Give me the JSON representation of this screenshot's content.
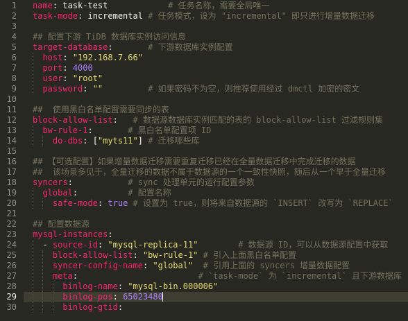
{
  "editor": {
    "language": "yaml",
    "active_line": 29,
    "lines": [
      {
        "no": "1",
        "tokens": [
          [
            "k",
            "name"
          ],
          [
            "p",
            ": "
          ],
          [
            "p",
            "task-test"
          ],
          [
            "p",
            "            "
          ],
          [
            "c",
            "# 任务名称，需要全局唯一"
          ]
        ]
      },
      {
        "no": "2",
        "tokens": [
          [
            "k",
            "task-mode"
          ],
          [
            "p",
            ": "
          ],
          [
            "p",
            "incremental"
          ],
          [
            "p",
            " "
          ],
          [
            "c",
            "# 任务模式，设为 \"incremental\" 即只进行增量数据迁移"
          ]
        ]
      },
      {
        "no": "3",
        "tokens": []
      },
      {
        "no": "4",
        "tokens": [
          [
            "c",
            "## 配置下游 TiDB 数据库实例访问信息"
          ]
        ]
      },
      {
        "no": "5",
        "tokens": [
          [
            "k",
            "target-database"
          ],
          [
            "p",
            ":       "
          ],
          [
            "c",
            "# 下游数据库实例配置"
          ]
        ]
      },
      {
        "no": "6",
        "tokens": [
          [
            "p",
            "  "
          ],
          [
            "k",
            "host"
          ],
          [
            "p",
            ": "
          ],
          [
            "s",
            "\"192.168.7.66\""
          ]
        ]
      },
      {
        "no": "7",
        "tokens": [
          [
            "p",
            "  "
          ],
          [
            "k",
            "port"
          ],
          [
            "p",
            ": "
          ],
          [
            "n",
            "4000"
          ]
        ]
      },
      {
        "no": "8",
        "tokens": [
          [
            "p",
            "  "
          ],
          [
            "k",
            "user"
          ],
          [
            "p",
            ": "
          ],
          [
            "s",
            "\"root\""
          ]
        ]
      },
      {
        "no": "9",
        "tokens": [
          [
            "p",
            "  "
          ],
          [
            "k",
            "password"
          ],
          [
            "p",
            ": "
          ],
          [
            "s",
            "\"\""
          ],
          [
            "p",
            "         "
          ],
          [
            "c",
            "# 如果密码不为空，则推荐使用经过 dmctl 加密的密文"
          ]
        ]
      },
      {
        "no": "10",
        "tokens": []
      },
      {
        "no": "11",
        "tokens": [
          [
            "c",
            "##  使用黑白名单配置需要同步的表"
          ]
        ]
      },
      {
        "no": "12",
        "tokens": [
          [
            "k",
            "block-allow-list"
          ],
          [
            "p",
            ":   "
          ],
          [
            "c",
            "# 数据源数据库实例匹配的表的 block-allow-list 过滤规则集"
          ]
        ]
      },
      {
        "no": "13",
        "tokens": [
          [
            "p",
            "  "
          ],
          [
            "k",
            "bw-rule-1"
          ],
          [
            "p",
            ":       "
          ],
          [
            "c",
            "# 黑白名单配置项 ID"
          ]
        ]
      },
      {
        "no": "14",
        "tokens": [
          [
            "p",
            "    "
          ],
          [
            "k",
            "do-dbs"
          ],
          [
            "p",
            ": ["
          ],
          [
            "s",
            "\"myts11\""
          ],
          [
            "p",
            "] "
          ],
          [
            "c",
            "# 迁移哪些库"
          ]
        ]
      },
      {
        "no": "15",
        "tokens": []
      },
      {
        "no": "16",
        "tokens": [
          [
            "c",
            "## 【可选配置】如果增量数据迁移需要重复迁移已经在全量数据迁移中完成迁移的数据"
          ]
        ]
      },
      {
        "no": "17",
        "tokens": [
          [
            "c",
            "##  该场景多见于，全量迁移的数据不属于数据源的一个一致性快照，随后从一个早于全量迁移"
          ]
        ]
      },
      {
        "no": "18",
        "tokens": [
          [
            "k",
            "syncers"
          ],
          [
            "p",
            ":           "
          ],
          [
            "c",
            "# sync 处理单元的运行配置参数"
          ]
        ]
      },
      {
        "no": "19",
        "tokens": [
          [
            "p",
            "  "
          ],
          [
            "k",
            "global"
          ],
          [
            "p",
            ":          "
          ],
          [
            "c",
            "# 配置名称"
          ]
        ]
      },
      {
        "no": "20",
        "tokens": [
          [
            "p",
            "    "
          ],
          [
            "k",
            "safe-mode"
          ],
          [
            "p",
            ": "
          ],
          [
            "n",
            "true"
          ],
          [
            "p",
            " "
          ],
          [
            "c",
            "# 设置为 true，则将来自数据源的 `INSERT` 改写为 `REPLACE`"
          ]
        ]
      },
      {
        "no": "21",
        "tokens": []
      },
      {
        "no": "22",
        "tokens": [
          [
            "c",
            "## 配置数据源"
          ]
        ]
      },
      {
        "no": "23",
        "tokens": [
          [
            "k",
            "mysql-instances"
          ],
          [
            "p",
            ":"
          ]
        ]
      },
      {
        "no": "24",
        "tokens": [
          [
            "p",
            "  - "
          ],
          [
            "k",
            "source-id"
          ],
          [
            "p",
            ": "
          ],
          [
            "s",
            "\"mysql-replica-11\""
          ],
          [
            "p",
            "        "
          ],
          [
            "c",
            "# 数据源 ID，可以从数据源配置中获取"
          ]
        ]
      },
      {
        "no": "25",
        "tokens": [
          [
            "p",
            "    "
          ],
          [
            "k",
            "block-allow-list"
          ],
          [
            "p",
            ": "
          ],
          [
            "s",
            "\"bw-rule-1\""
          ],
          [
            "p",
            " "
          ],
          [
            "c",
            "# 引入上面黑白名单配置"
          ]
        ]
      },
      {
        "no": "26",
        "tokens": [
          [
            "p",
            "    "
          ],
          [
            "k",
            "syncer-config-name"
          ],
          [
            "p",
            ": "
          ],
          [
            "s",
            "\"global\""
          ],
          [
            "p",
            "  "
          ],
          [
            "c",
            "# 引用上面的 syncers 增量数据配置"
          ]
        ]
      },
      {
        "no": "27",
        "tokens": [
          [
            "p",
            "    "
          ],
          [
            "k",
            "meta"
          ],
          [
            "p",
            ":                        "
          ],
          [
            "c",
            "# `task-mode` 为 `incremental` 且下游数据库"
          ]
        ]
      },
      {
        "no": "28",
        "tokens": [
          [
            "p",
            "      "
          ],
          [
            "k",
            "binlog-name"
          ],
          [
            "p",
            ": "
          ],
          [
            "s",
            "\"mysql-bin.000006\""
          ]
        ]
      },
      {
        "no": "29",
        "tokens": [
          [
            "p",
            "      "
          ],
          [
            "k",
            "binlog-pos"
          ],
          [
            "p",
            ": "
          ],
          [
            "n",
            "65023480"
          ]
        ]
      },
      {
        "no": "30",
        "tokens": [
          [
            "p",
            "      "
          ],
          [
            "k",
            "binlog-gtid"
          ],
          [
            "p",
            ":"
          ]
        ]
      }
    ]
  }
}
